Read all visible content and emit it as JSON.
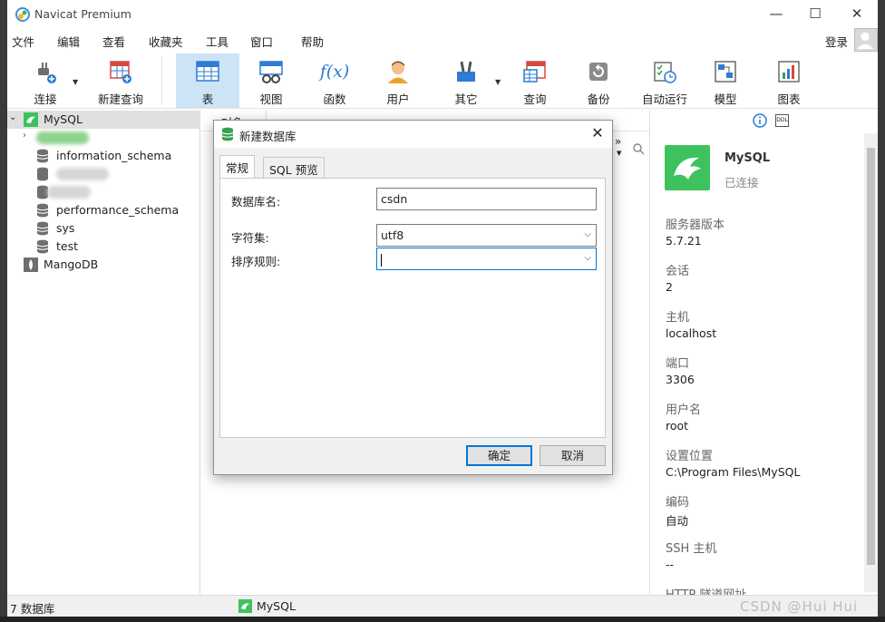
{
  "window": {
    "title": "Navicat Premium",
    "minimize": "—",
    "maximize": "☐",
    "close": "✕"
  },
  "menu": [
    "文件",
    "编辑",
    "查看",
    "收藏夹",
    "工具",
    "窗口",
    "帮助"
  ],
  "login_label": "登录",
  "toolbar": [
    {
      "label": "连接",
      "icon": "plug-icon"
    },
    {
      "label": "新建查询",
      "icon": "new-query-icon"
    },
    {
      "label": "表",
      "icon": "table-icon",
      "active": true
    },
    {
      "label": "视图",
      "icon": "view-icon"
    },
    {
      "label": "函数",
      "icon": "function-icon",
      "glyph": "f(x)"
    },
    {
      "label": "用户",
      "icon": "user-icon"
    },
    {
      "label": "其它",
      "icon": "tools-icon"
    },
    {
      "label": "查询",
      "icon": "query-icon"
    },
    {
      "label": "备份",
      "icon": "backup-icon"
    },
    {
      "label": "自动运行",
      "icon": "schedule-icon"
    },
    {
      "label": "模型",
      "icon": "model-icon"
    },
    {
      "label": "图表",
      "icon": "chart-icon"
    }
  ],
  "tree": {
    "connection": "MySQL",
    "databases": [
      "information_schema",
      "performance_schema",
      "sys",
      "test"
    ],
    "other_connection": "MangoDB"
  },
  "center": {
    "tab_label": "对象"
  },
  "dialog": {
    "title": "新建数据库",
    "tabs": [
      "常规",
      "SQL 预览"
    ],
    "fields": {
      "db_name_label": "数据库名:",
      "db_name_value": "csdn",
      "charset_label": "字符集:",
      "charset_value": "utf8",
      "collation_label": "排序规则:",
      "collation_value": ""
    },
    "ok": "确定",
    "cancel": "取消"
  },
  "info_panel": {
    "name": "MySQL",
    "status": "已连接",
    "ddl_badge": "DDL",
    "items": [
      {
        "key": "服务器版本",
        "value": "5.7.21"
      },
      {
        "key": "会话",
        "value": "2"
      },
      {
        "key": "主机",
        "value": "localhost"
      },
      {
        "key": "端口",
        "value": "3306"
      },
      {
        "key": "用户名",
        "value": "root"
      },
      {
        "key": "设置位置",
        "value": "C:\\Program Files\\MySQL"
      },
      {
        "key": "编码",
        "value": "自动"
      },
      {
        "key": "SSH 主机",
        "value": "--"
      },
      {
        "key": "HTTP 隧道网址",
        "value": ""
      }
    ]
  },
  "statusbar": {
    "count": "7 数据库",
    "connection": "MySQL"
  },
  "watermark": "CSDN @Hui Hui",
  "colors": {
    "accent": "#0078d7",
    "active_tool": "#cde4f7",
    "mysql_green": "#3ec25e"
  }
}
